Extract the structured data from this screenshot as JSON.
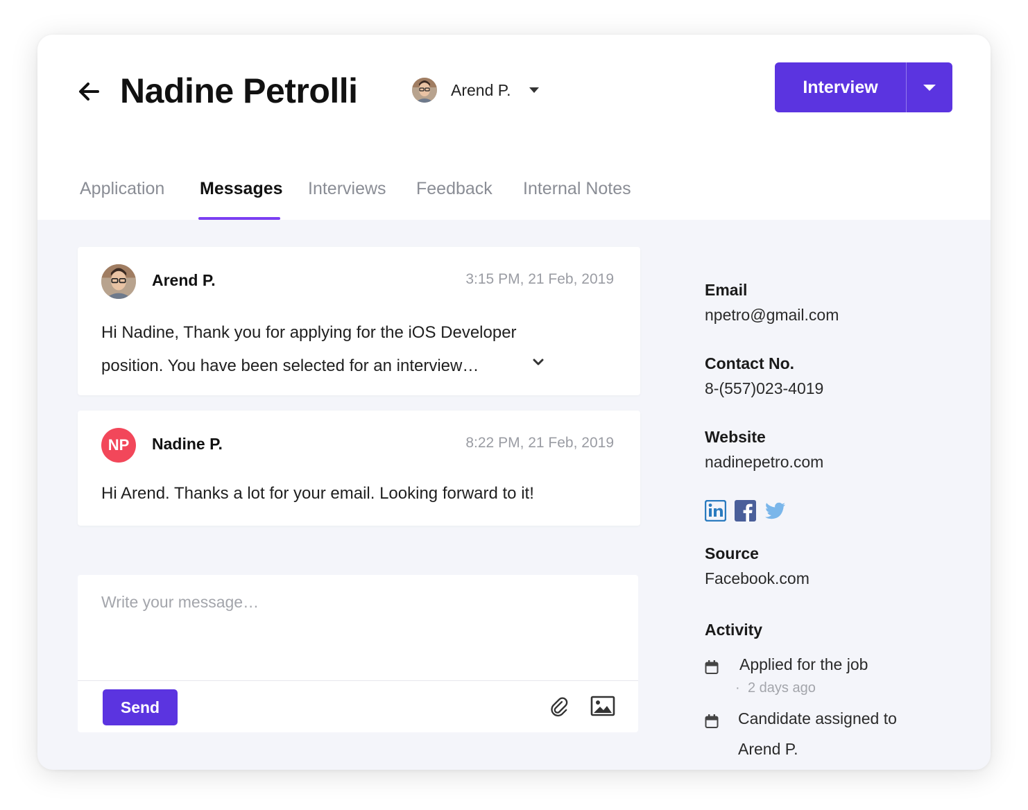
{
  "header": {
    "title": "Nadine Petrolli",
    "assignee": "Arend P.",
    "stage_button": "Interview"
  },
  "tabs": [
    {
      "label": "Application",
      "active": false
    },
    {
      "label": "Messages",
      "active": true
    },
    {
      "label": "Interviews",
      "active": false
    },
    {
      "label": "Feedback",
      "active": false
    },
    {
      "label": "Internal Notes",
      "active": false
    }
  ],
  "messages": [
    {
      "author": "Arend P.",
      "time": "3:15 PM, 21 Feb, 2019",
      "body": "Hi Nadine, Thank you for applying for the iOS Developer position. You have been selected for an interview…"
    },
    {
      "author": "Nadine P.",
      "initials": "NP",
      "time": "8:22 PM, 21 Feb, 2019",
      "body": "Hi Arend. Thanks a lot for your email. Looking forward to it!"
    }
  ],
  "composer": {
    "placeholder": "Write your message…",
    "send_label": "Send"
  },
  "sidebar": {
    "email_label": "Email",
    "email": "npetro@gmail.com",
    "contact_label": "Contact No.",
    "contact": "8-(557)023-4019",
    "website_label": "Website",
    "website": "nadinepetro.com",
    "social": [
      "linkedin-icon",
      "facebook-icon",
      "twitter-icon"
    ],
    "source_label": "Source",
    "source": "Facebook.com",
    "activity_label": "Activity",
    "activity": [
      {
        "text": "Applied for the job",
        "meta": "2 days ago"
      },
      {
        "text_line1": "Candidate assigned to",
        "text_line2": "Arend P."
      }
    ]
  },
  "colors": {
    "accent": "#5b34e0",
    "tab_underline": "#7b3ff2",
    "initials_avatar": "#f2475a",
    "background": "#f4f5fa"
  }
}
